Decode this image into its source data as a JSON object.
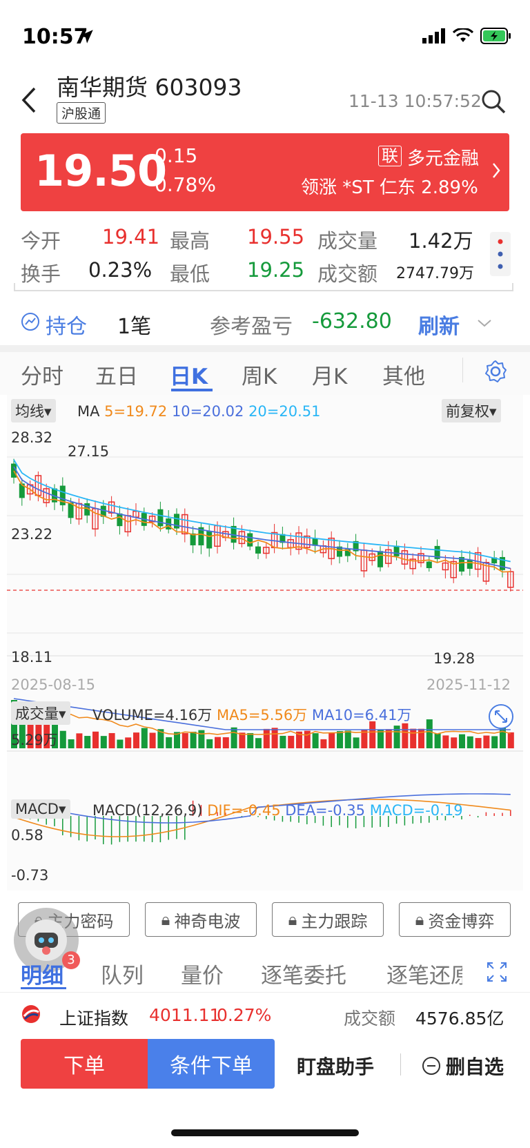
{
  "status": {
    "time": "10:57"
  },
  "header": {
    "name": "南华期货",
    "code": "603093",
    "tag": "沪股通",
    "timestamp": "11-13 10:57:52"
  },
  "quote": {
    "price": "19.50",
    "change": "0.15",
    "change_pct": "0.78%",
    "board_badge": "联",
    "board_name": "多元金融",
    "leader_text": "领涨 *ST 仁东 2.89%"
  },
  "stats": {
    "open_label": "今开",
    "open": "19.41",
    "high_label": "最高",
    "high": "19.55",
    "volume_label": "成交量",
    "volume": "1.42万",
    "turnover_label": "换手",
    "turnover": "0.23%",
    "low_label": "最低",
    "low": "19.25",
    "amount_label": "成交额",
    "amount": "2747.79万"
  },
  "holding": {
    "label": "持仓",
    "count": "1笔",
    "pnl_label": "参考盈亏",
    "pnl": "-632.80",
    "refresh": "刷新"
  },
  "tabs": [
    "分时",
    "五日",
    "日K",
    "周K",
    "月K",
    "其他"
  ],
  "chart": {
    "ma_button": "均线",
    "ma_prefix": "MA",
    "ma5": "5=19.72",
    "ma10": "10=20.02",
    "ma20": "20=20.51",
    "adjust_button": "前复权",
    "price_max": "28.32",
    "price_mid": "23.22",
    "price_min": "18.11",
    "peak_label": "27.15",
    "low_label": "19.28",
    "date_start": "2025-08-15",
    "date_end": "2025-11-12",
    "vol_button": "成交量",
    "vol_text": "VOLUME=4.16万",
    "vol_ma5": "MA5=5.56万",
    "vol_ma10": "MA10=6.41万",
    "vol_axis": "5.29万",
    "macd_button": "MACD",
    "macd_param": "MACD(12,26,9)",
    "dif": "DIF=-0.45",
    "dea": "DEA=-0.35",
    "macd_val": "MACD=-0.19",
    "macd_max": "0.58",
    "macd_min": "-0.73",
    "colors": {
      "up": "#e8302e",
      "down": "#159a3b",
      "ma5": "#f08a1c",
      "ma10": "#4a6fdc",
      "ma20": "#29b6f6"
    }
  },
  "features": [
    "主力密码",
    "神奇电波",
    "主力跟踪",
    "资金博弈"
  ],
  "bottom_tabs": [
    "明细",
    "队列",
    "量价",
    "逐笔委托",
    "逐笔还原"
  ],
  "badge_count": "3",
  "index": {
    "name": "上证指数",
    "value": "4011.11",
    "pct": "0.27%",
    "amount_label": "成交额",
    "amount": "4576.85亿"
  },
  "actions": {
    "order": "下单",
    "conditional": "条件下单",
    "assistant": "盯盘助手",
    "remove_watch": "删自选"
  }
}
